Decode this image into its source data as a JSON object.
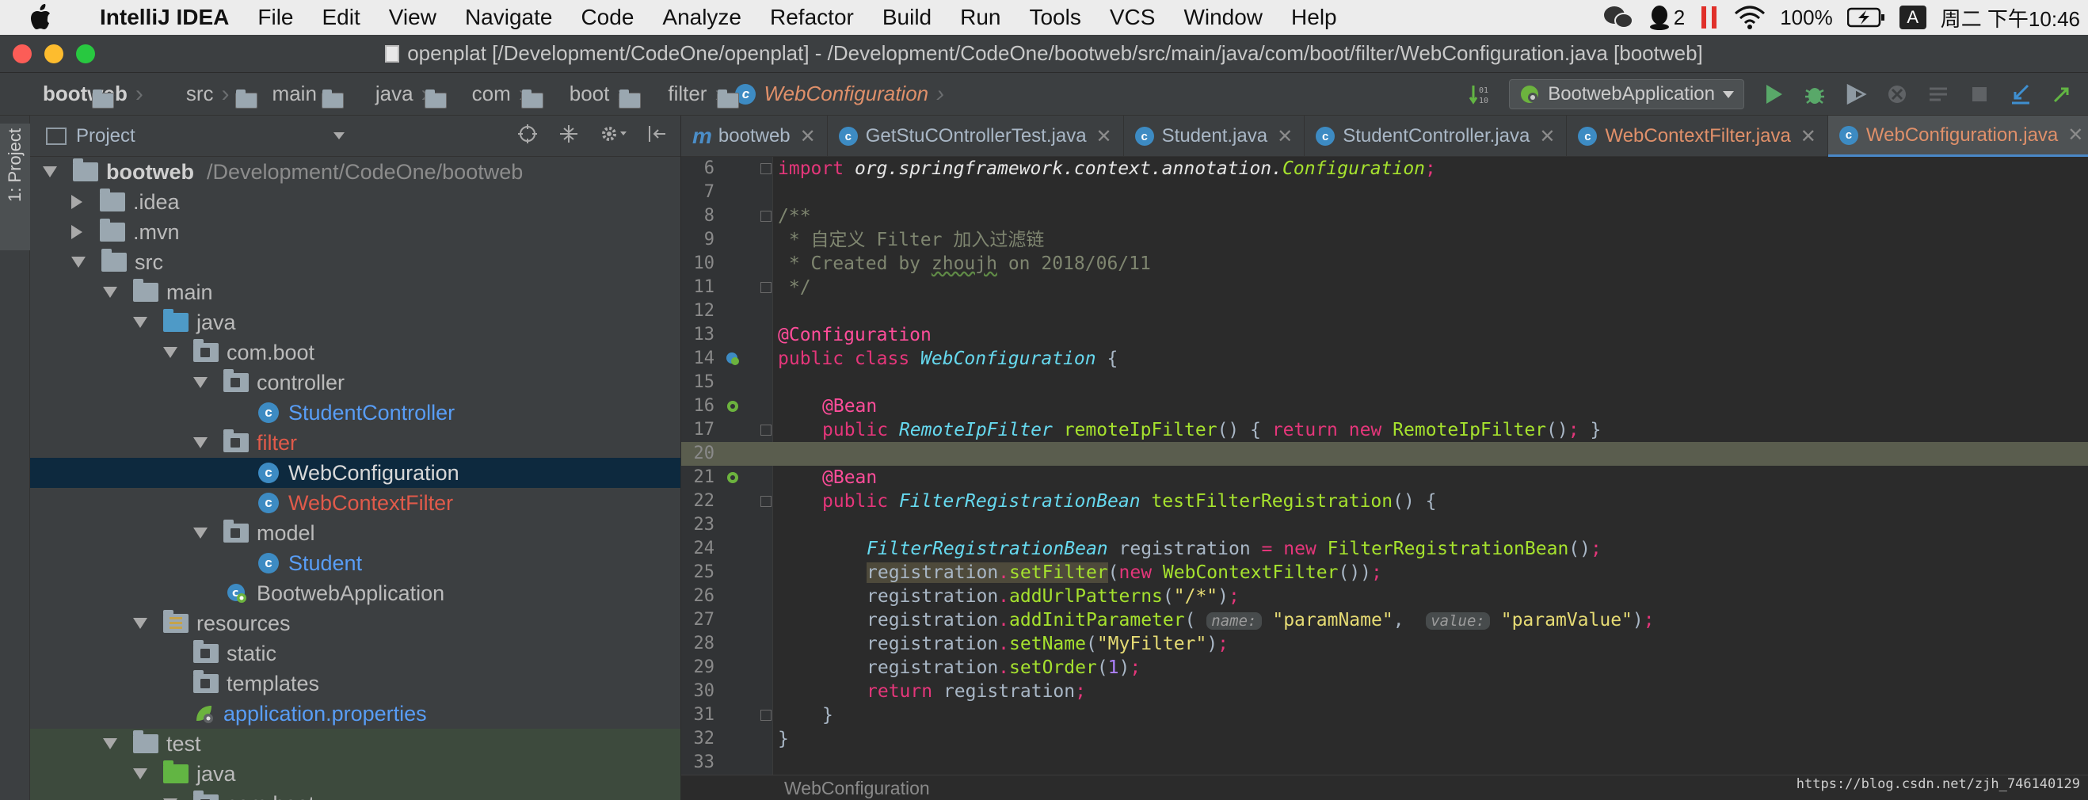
{
  "menubar": {
    "app": "IntelliJ IDEA",
    "items": [
      "File",
      "Edit",
      "View",
      "Navigate",
      "Code",
      "Analyze",
      "Refactor",
      "Build",
      "Run",
      "Tools",
      "VCS",
      "Window",
      "Help"
    ],
    "status": {
      "qq_count": "2",
      "battery": "100%",
      "input_source": "A",
      "clock": "周二 下午10:46"
    }
  },
  "window": {
    "title": "openplat [/Development/CodeOne/openplat] - /Development/CodeOne/bootweb/src/main/java/com/boot/filter/WebConfiguration.java [bootweb]"
  },
  "breadcrumbs": [
    "bootweb",
    "src",
    "main",
    "java",
    "com",
    "boot",
    "filter",
    "WebConfiguration"
  ],
  "run_config": {
    "label": "BootwebApplication"
  },
  "left_strip": {
    "tab": "1: Project"
  },
  "project_panel": {
    "header": "Project",
    "tree": [
      {
        "label": "bootweb",
        "extra": "/Development/CodeOne/bootweb"
      },
      {
        "label": ".idea"
      },
      {
        "label": ".mvn"
      },
      {
        "label": "src"
      },
      {
        "label": "main"
      },
      {
        "label": "java"
      },
      {
        "label": "com.boot"
      },
      {
        "label": "controller"
      },
      {
        "label": "StudentController"
      },
      {
        "label": "filter"
      },
      {
        "label": "WebConfiguration"
      },
      {
        "label": "WebContextFilter"
      },
      {
        "label": "model"
      },
      {
        "label": "Student"
      },
      {
        "label": "BootwebApplication"
      },
      {
        "label": "resources"
      },
      {
        "label": "static"
      },
      {
        "label": "templates"
      },
      {
        "label": "application.properties"
      },
      {
        "label": "test"
      },
      {
        "label": "java"
      },
      {
        "label": "com.boot"
      }
    ]
  },
  "editor": {
    "tabs": [
      "bootweb",
      "GetStuCOntrollerTest.java",
      "Student.java",
      "StudentController.java",
      "WebContextFilter.java",
      "WebConfiguration.java"
    ],
    "line_numbers": [
      "6",
      "7",
      "8",
      "9",
      "10",
      "11",
      "12",
      "13",
      "14",
      "15",
      "16",
      "17",
      "20",
      "21",
      "22",
      "23",
      "24",
      "25",
      "26",
      "27",
      "28",
      "29",
      "30",
      "31",
      "32",
      "33"
    ],
    "code": {
      "l6_kw": "import",
      "l6_pkg": "org.springframework.context.annotation.",
      "l6_cls": "Configuration",
      "l8": "/**",
      "l9": " * 自定义 Filter 加入过滤链",
      "l10_a": " * Created by ",
      "l10_b": "zhoujh",
      "l10_c": " on 2018/06/11",
      "l11": " */",
      "l13": "@Configuration",
      "l14_kw": "public class",
      "l14_cls": "WebConfiguration",
      "l16": "@Bean",
      "l17_kw": "public",
      "l17_cls": "RemoteIpFilter",
      "l17_m": "remoteIpFilter",
      "l17_ret": "return new",
      "l17_cls2": "RemoteIpFilter",
      "l21": "@Bean",
      "l22_kw": "public",
      "l22_cls": "FilterRegistrationBean",
      "l22_m": "testFilterRegistration",
      "l24_cls": "FilterRegistrationBean",
      "l24_var": "registration",
      "l24_new": "new",
      "l24_cls2": "FilterRegistrationBean",
      "l25_var": "registration",
      "l25_m": "setFilter",
      "l25_new": "new",
      "l25_cls": "WebContextFilter",
      "l26_var": "registration",
      "l26_m": "addUrlPatterns",
      "l26_str": "\"/*\"",
      "l27_var": "registration",
      "l27_m": "addInitParameter",
      "l27_h1": "name:",
      "l27_s1": "\"paramName\"",
      "l27_h2": "value:",
      "l27_s2": "\"paramValue\"",
      "l28_var": "registration",
      "l28_m": "setName",
      "l28_str": "\"MyFilter\"",
      "l29_var": "registration",
      "l29_m": "setOrder",
      "l29_num": "1",
      "l30_kw": "return",
      "l30_var": "registration"
    },
    "footer": "WebConfiguration"
  },
  "watermark": "https://blog.csdn.net/zjh_746140129"
}
